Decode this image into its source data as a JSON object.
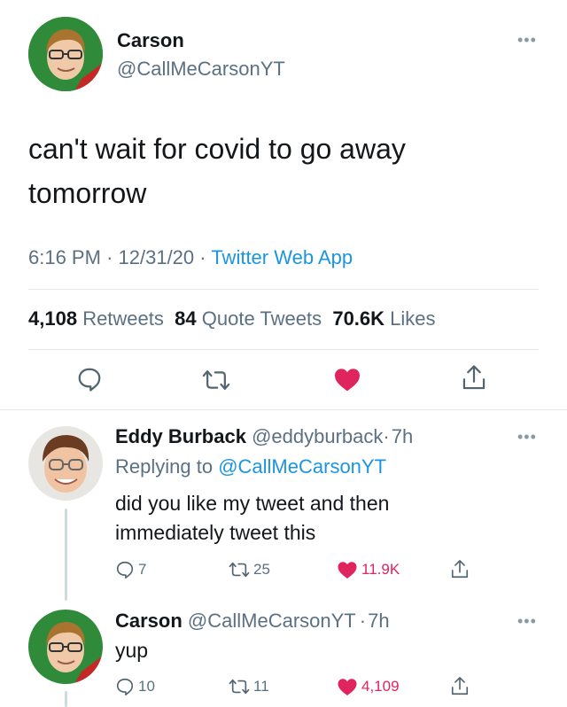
{
  "main": {
    "author_name": "Carson",
    "author_handle": "@CallMeCarsonYT",
    "text_line1": "can't wait for covid to go away",
    "text_line2": "tomorrow",
    "time": "6:16 PM",
    "sep": "·",
    "date": "12/31/20",
    "source": "Twitter Web App",
    "retweets_count": "4,108",
    "retweets_label": "Retweets",
    "quotes_count": "84",
    "quotes_label": "Quote Tweets",
    "likes_count": "70.6K",
    "likes_label": "Likes"
  },
  "reply1": {
    "name": "Eddy Burback",
    "handle": "@eddyburback",
    "sep": "·",
    "time": "7h",
    "replying_label": "Replying to",
    "replying_handle": "@CallMeCarsonYT",
    "text_line1": "did you like my tweet and then",
    "text_line2": "immediately tweet this",
    "replies": "7",
    "retweets": "25",
    "likes": "11.9K"
  },
  "reply2": {
    "name": "Carson",
    "handle": "@CallMeCarsonYT",
    "sep": "·",
    "time": "7h",
    "text": "yup",
    "replies": "10",
    "retweets": "11",
    "likes": "4,109"
  },
  "icons": {
    "more": "more-icon",
    "reply": "reply-icon",
    "retweet": "retweet-icon",
    "like": "heart-icon",
    "share": "share-icon"
  },
  "colors": {
    "like": "#e0245e",
    "link": "#1b95e0",
    "muted": "#5b7083",
    "icon": "#536471"
  }
}
